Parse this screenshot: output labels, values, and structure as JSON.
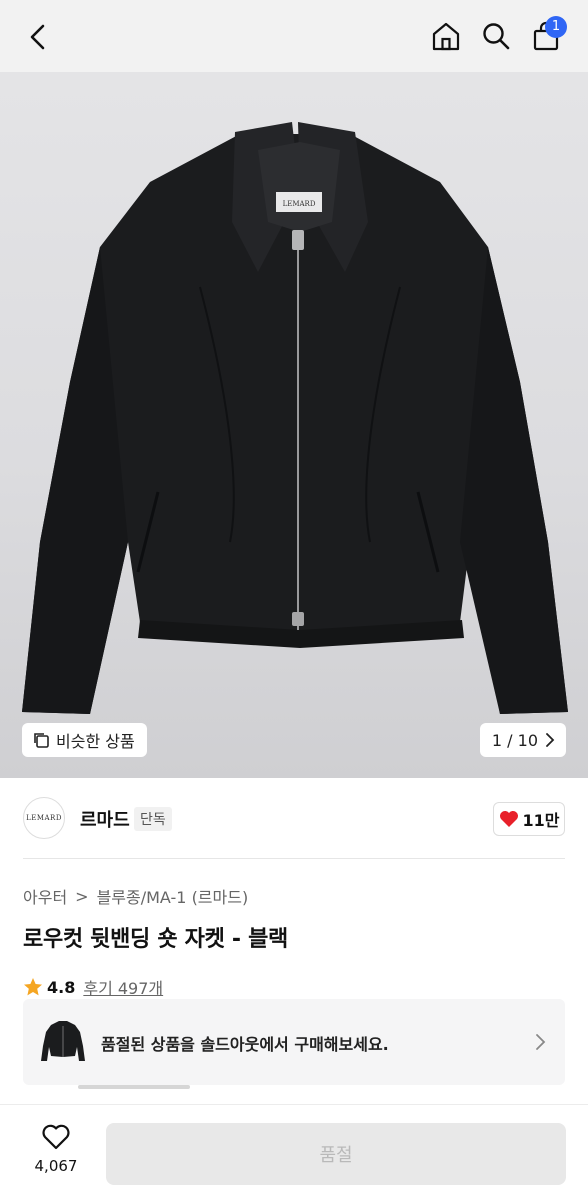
{
  "header": {
    "back_icon": "chevron-left-icon",
    "home_icon": "home-icon",
    "search_icon": "search-icon",
    "cart_icon": "shopping-bag-icon",
    "cart_count": "1",
    "badge_color": "#2f66f5"
  },
  "gallery": {
    "label_on_product": "LEMARD",
    "similar_label": "비슷한 상품",
    "pager": "1 / 10"
  },
  "brand": {
    "logo_text": "LEMARD",
    "name": "르마드",
    "tag": "단독",
    "likes": "11만",
    "heart_color": "#e8202a"
  },
  "breadcrumb": {
    "level1": "아우터",
    "separator": ">",
    "level2": "블루종/MA-1 (르마드)"
  },
  "product": {
    "title": "로우컷 뒷밴딩 숏 자켓 - 블랙"
  },
  "rating": {
    "score": "4.8",
    "reviews": "후기 497개",
    "star_color": "#f5a623"
  },
  "soldout_banner": {
    "message": "품절된 상품을 솔드아웃에서 구매해보세요."
  },
  "bottom": {
    "wish_count": "4,067",
    "buy_label": "품절"
  }
}
